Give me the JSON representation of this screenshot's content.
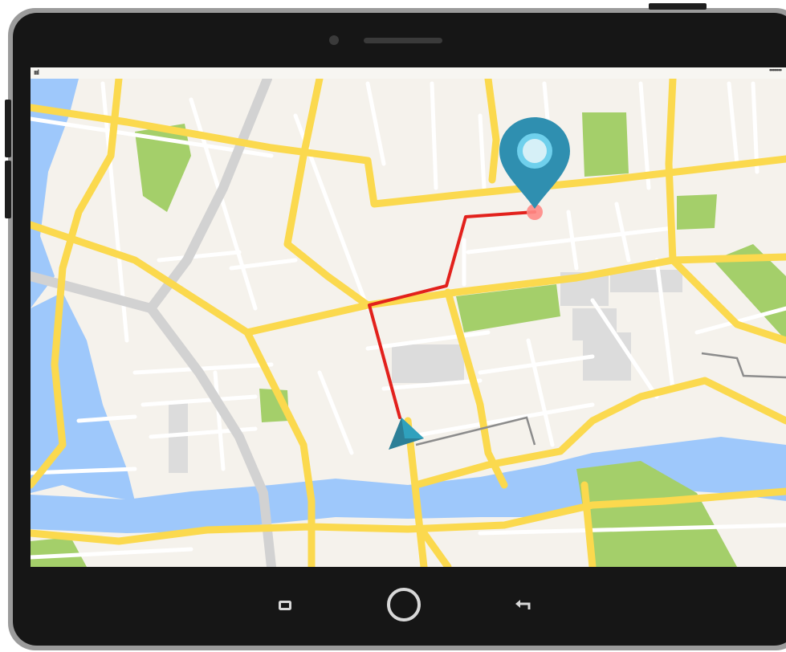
{
  "device": {
    "status_bar": {
      "signal_text": "ıııl",
      "menu_text": "•••••••"
    },
    "navigation": [
      {
        "name": "recent-apps-button",
        "icon": "square-icon"
      },
      {
        "name": "home-button",
        "icon": "circle-icon"
      },
      {
        "name": "back-button",
        "icon": "back-arrow-icon"
      }
    ]
  },
  "map": {
    "colors": {
      "land": "#f5f2ec",
      "major_road": "#fbd94e",
      "minor_road": "#ffffff",
      "highway": "#d2d2d2",
      "park": "#a4cf6a",
      "water": "#9ec8fb",
      "building_block": "#dcdcdc",
      "route": "#e2211c",
      "pin": "#2f8fb0",
      "navigation_arrow": "#2c7f97"
    },
    "route_label": "navigation-route",
    "destination": "destination-pin",
    "current_location": "current-location-arrow"
  }
}
